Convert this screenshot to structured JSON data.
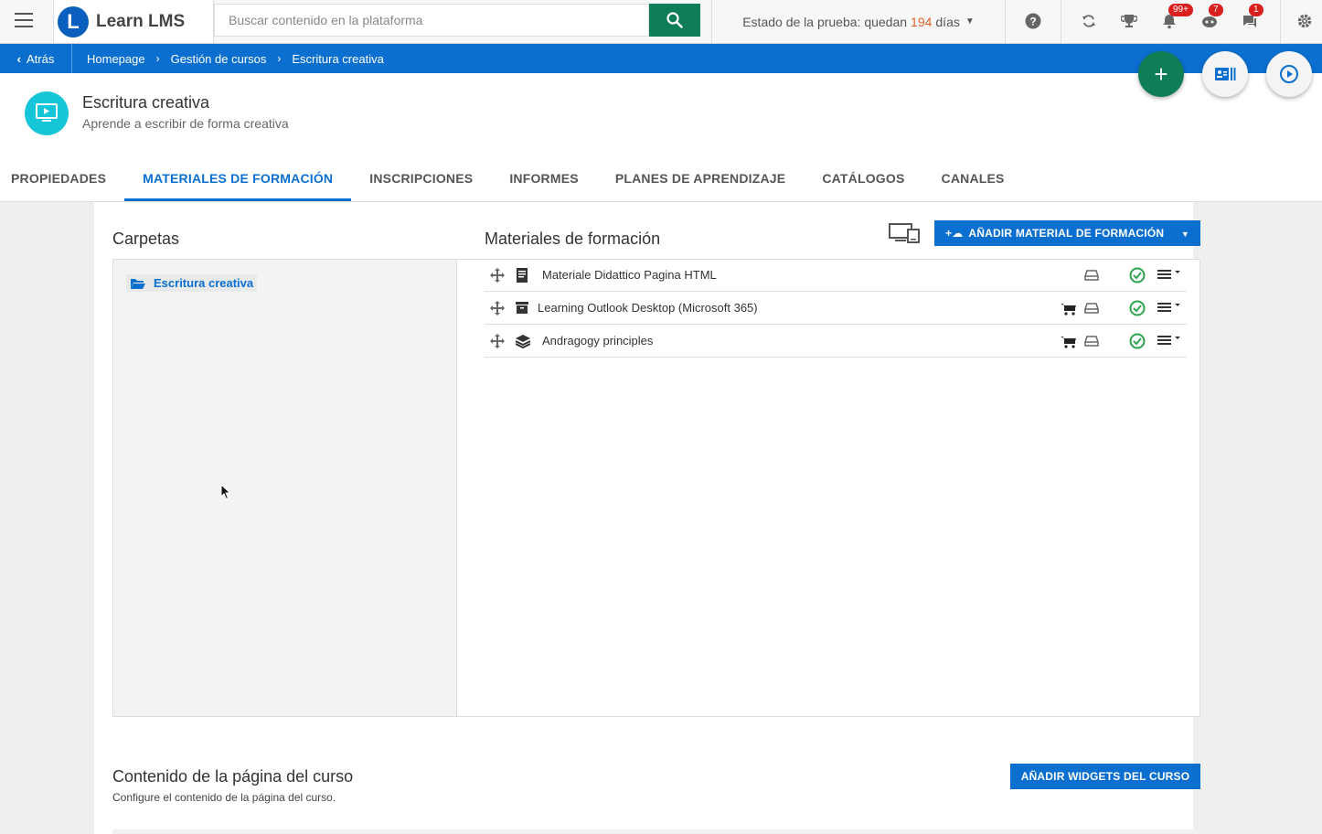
{
  "topbar": {
    "logo_letter": "L",
    "logo_text": "Learn LMS",
    "search_placeholder": "Buscar contenido en la plataforma",
    "trial_prefix": "Estado de la prueba: quedan",
    "trial_days": "194",
    "trial_suffix": "días",
    "badges": {
      "notifications": "99+",
      "messages_bot": "7",
      "chat": "1"
    }
  },
  "breadcrumb": {
    "back": "Atrás",
    "items": [
      "Homepage",
      "Gestión de cursos",
      "Escritura creativa"
    ]
  },
  "course": {
    "title": "Escritura creativa",
    "subtitle": "Aprende a escribir de forma creativa"
  },
  "tabs": [
    {
      "label": "PROPIEDADES",
      "active": false
    },
    {
      "label": "MATERIALES DE FORMACIÓN",
      "active": true
    },
    {
      "label": "INSCRIPCIONES",
      "active": false
    },
    {
      "label": "INFORMES",
      "active": false
    },
    {
      "label": "PLANES DE APRENDIZAJE",
      "active": false
    },
    {
      "label": "CATÁLOGOS",
      "active": false
    },
    {
      "label": "CANALES",
      "active": false
    }
  ],
  "folders": {
    "title": "Carpetas",
    "items": [
      "Escritura creativa"
    ]
  },
  "materials": {
    "title": "Materiales de formación",
    "add_button": "AÑADIR MATERIAL DE FORMACIÓN",
    "rows": [
      {
        "name": "Materiale Didattico Pagina HTML",
        "type_icon": "html-page-icon",
        "cart": false
      },
      {
        "name": "Learning Outlook Desktop (Microsoft 365)",
        "type_icon": "package-icon",
        "cart": true
      },
      {
        "name": "Andragogy principles",
        "type_icon": "layers-icon",
        "cart": true
      }
    ]
  },
  "widgets": {
    "title": "Contenido de la página del curso",
    "subtitle": "Configure el contenido de la página del curso.",
    "button": "AÑADIR WIDGETS DEL CURSO"
  },
  "colors": {
    "primary": "#0b6fcf",
    "green": "#0f7d55",
    "teal": "#17c5d9",
    "badge_red": "#d9201e",
    "trial_days": "#e0622a"
  }
}
